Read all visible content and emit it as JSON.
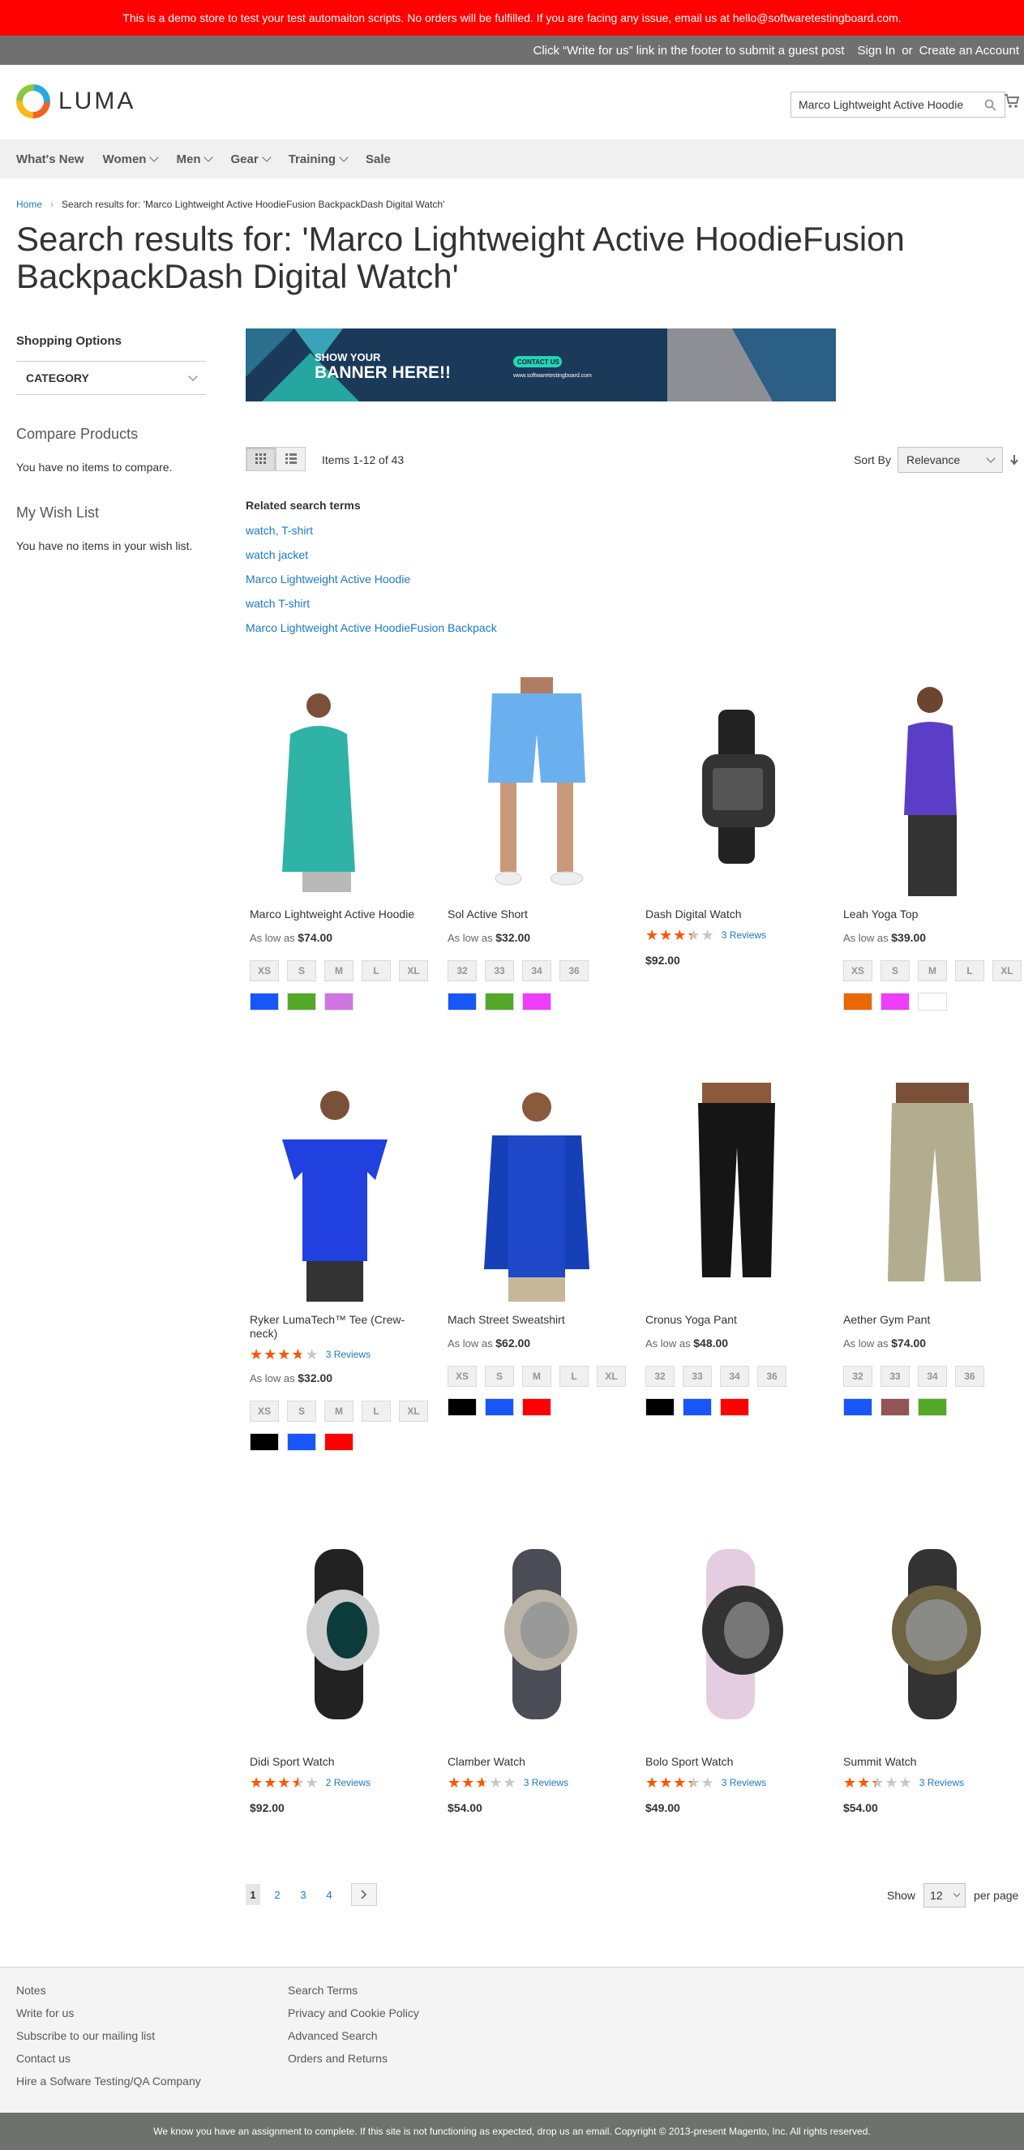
{
  "demo_notice": "This is a demo store to test your test automaiton scripts. No orders will be fulfilled. If you are facing any issue, email us at hello@softwaretestingboard.com.",
  "header_panel": {
    "message": "Click “Write for us” link in the footer to submit a guest post",
    "sign_in": "Sign In",
    "or": "or",
    "create_account": "Create an Account"
  },
  "logo": {
    "text": "LUMA"
  },
  "search": {
    "value": "Marco Lightweight Active Hoodie"
  },
  "nav": [
    "What's New",
    "Women",
    "Men",
    "Gear",
    "Training",
    "Sale"
  ],
  "breadcrumb": {
    "home": "Home",
    "current": "Search results for: 'Marco Lightweight Active HoodieFusion BackpackDash Digital Watch'"
  },
  "page_title": "Search results for: 'Marco Lightweight Active HoodieFusion BackpackDash Digital Watch'",
  "sidebar": {
    "shopping_options": "Shopping Options",
    "category": "CATEGORY",
    "compare_title": "Compare Products",
    "compare_text": "You have no items to compare.",
    "wishlist_title": "My Wish List",
    "wishlist_text": "You have no items in your wish list."
  },
  "banner": {
    "line1": "SHOW YOUR",
    "line2": "BANNER HERE!!",
    "cta": "CONTACT US",
    "url": "www.softwaretestingboard.com"
  },
  "toolbar": {
    "amount": "Items 1-12 of 43",
    "sort_label": "Sort By",
    "sort_value": "Relevance"
  },
  "related": {
    "title": "Related search terms",
    "terms": [
      "watch, T-shirt",
      "watch jacket",
      "Marco Lightweight Active Hoodie",
      "watch T-shirt",
      "Marco Lightweight Active HoodieFusion Backpack"
    ]
  },
  "as_low_as": "As low as",
  "products": [
    {
      "name": "Marco Lightweight Active Hoodie",
      "price": "$74.00",
      "as_low": true,
      "sizes": [
        "XS",
        "S",
        "M",
        "L",
        "XL"
      ],
      "colors": [
        "#1857f7",
        "#53a828",
        "#cf75e0"
      ],
      "rating": null,
      "reviews": ""
    },
    {
      "name": "Sol Active Short",
      "price": "$32.00",
      "as_low": true,
      "sizes": [
        "32",
        "33",
        "34",
        "36"
      ],
      "colors": [
        "#1857f7",
        "#53a828",
        "#ef3dff"
      ],
      "rating": null,
      "reviews": ""
    },
    {
      "name": "Dash Digital Watch",
      "price": "$92.00",
      "as_low": false,
      "sizes": [],
      "colors": [],
      "rating": 0.67,
      "reviews": "3 Reviews"
    },
    {
      "name": "Leah Yoga Top",
      "price": "$39.00",
      "as_low": true,
      "sizes": [
        "XS",
        "S",
        "M",
        "L",
        "XL"
      ],
      "colors": [
        "#eb6703",
        "#ef3dff",
        "#ffffff"
      ],
      "rating": null,
      "reviews": ""
    },
    {
      "name": "Ryker LumaTech™ Tee (Crew-neck)",
      "price": "$32.00",
      "as_low": true,
      "sizes": [
        "XS",
        "S",
        "M",
        "L",
        "XL"
      ],
      "colors": [
        "#000000",
        "#1857f7",
        "#ff0000"
      ],
      "rating": 0.73,
      "reviews": "3 Reviews"
    },
    {
      "name": "Mach Street Sweatshirt",
      "price": "$62.00",
      "as_low": true,
      "sizes": [
        "XS",
        "S",
        "M",
        "L",
        "XL"
      ],
      "colors": [
        "#000000",
        "#1857f7",
        "#ff0000"
      ],
      "rating": null,
      "reviews": ""
    },
    {
      "name": "Cronus Yoga Pant",
      "price": "$48.00",
      "as_low": true,
      "sizes": [
        "32",
        "33",
        "34",
        "36"
      ],
      "colors": [
        "#000000",
        "#1857f7",
        "#ff0000"
      ],
      "rating": null,
      "reviews": ""
    },
    {
      "name": "Aether Gym Pant",
      "price": "$74.00",
      "as_low": true,
      "sizes": [
        "32",
        "33",
        "34",
        "36"
      ],
      "colors": [
        "#1857f7",
        "#945454",
        "#53a828"
      ],
      "rating": null,
      "reviews": ""
    },
    {
      "name": "Didi Sport Watch",
      "price": "$92.00",
      "as_low": false,
      "sizes": [],
      "colors": [],
      "rating": 0.7,
      "reviews": "2 Reviews"
    },
    {
      "name": "Clamber Watch",
      "price": "$54.00",
      "as_low": false,
      "sizes": [],
      "colors": [],
      "rating": 0.53,
      "reviews": "3 Reviews"
    },
    {
      "name": "Bolo Sport Watch",
      "price": "$49.00",
      "as_low": false,
      "sizes": [],
      "colors": [],
      "rating": 0.67,
      "reviews": "3 Reviews"
    },
    {
      "name": "Summit Watch",
      "price": "$54.00",
      "as_low": false,
      "sizes": [],
      "colors": [],
      "rating": 0.47,
      "reviews": "3 Reviews"
    }
  ],
  "pager": {
    "pages": [
      "1",
      "2",
      "3",
      "4"
    ],
    "show": "Show",
    "limit": "12",
    "per_page": "per page"
  },
  "footer": {
    "col1": [
      "Notes",
      "Write for us",
      "Subscribe to our mailing list",
      "Contact us",
      "Hire a Sofware Testing/QA Company"
    ],
    "col2": [
      "Search Terms",
      "Privacy and Cookie Policy",
      "Advanced Search",
      "Orders and Returns"
    ]
  },
  "copyright": "We know you have an assignment to complete. If this site is not functioning as expected, drop us an email. Copyright © 2013-present Magento, Inc. All rights reserved."
}
